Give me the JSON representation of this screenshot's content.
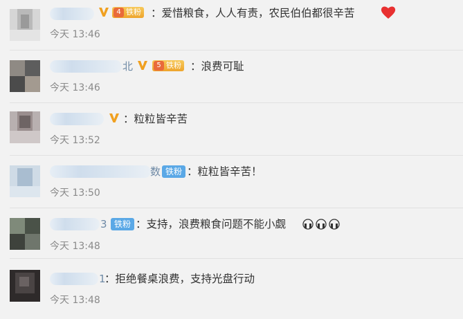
{
  "comments": [
    {
      "name_tail": "",
      "badge_type": "gold",
      "badge_level": "4",
      "badge_label": "铁粉",
      "text": "：爱惜粮食，人人有责，农民伯伯都很辛苦",
      "emoji": "heart-icon",
      "time": "今天 13:46"
    },
    {
      "name_tail": "北",
      "badge_type": "gold",
      "badge_level": "5",
      "badge_label": "铁粉",
      "text": "：浪费可耻",
      "time": "今天 13:46"
    },
    {
      "name_tail": "",
      "badge_type": "none",
      "text": "：粒粒皆辛苦",
      "time": "今天 13:52"
    },
    {
      "name_tail": "数",
      "badge_type": "blue",
      "badge_label": "铁粉",
      "text": "：粒粒皆辛苦！",
      "time": "今天 13:50"
    },
    {
      "name_tail": "3",
      "badge_type": "blue",
      "badge_label": "铁粉",
      "text": "：支持，浪费粮食问题不能小觑",
      "emoji": "sad-face-icon",
      "time": "今天 13:48"
    },
    {
      "name_tail": "1",
      "badge_type": "none",
      "text": "：拒绝餐桌浪费，支持光盘行动",
      "time": "今天 13:48"
    }
  ],
  "colors": {
    "vip": "#f0a020",
    "heart": "#e83030",
    "text": "#333333",
    "time": "#8a8a8a"
  }
}
